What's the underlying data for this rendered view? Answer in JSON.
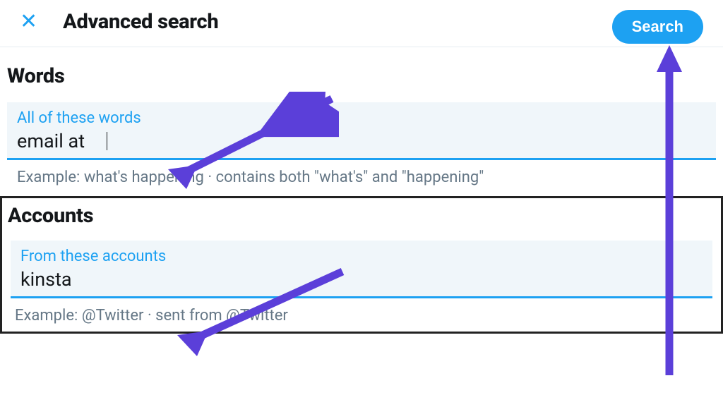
{
  "header": {
    "title": "Advanced search",
    "search_label": "Search"
  },
  "words": {
    "section_title": "Words",
    "all_words_label": "All of these words",
    "all_words_value": "email at",
    "all_words_hint": "Example: what's happening · contains both \"what's\" and \"happening\""
  },
  "accounts": {
    "section_title": "Accounts",
    "from_label": "From these accounts",
    "from_value": "kinsta",
    "from_hint": "Example: @Twitter · sent from @Twitter"
  },
  "annotation_color": "#5b3fd9"
}
